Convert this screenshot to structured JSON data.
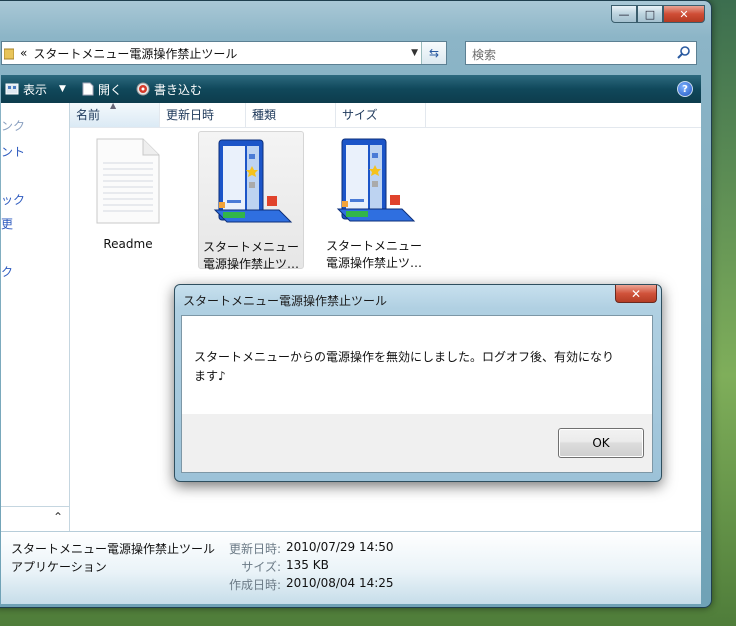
{
  "window": {
    "caption_buttons": {
      "minimize": "—",
      "maximize": "□",
      "close": "✕"
    }
  },
  "address": {
    "chevron": "«",
    "path": "スタートメニュー電源操作禁止ツール",
    "search_placeholder": "検索"
  },
  "toolbar": {
    "view_label": "表示",
    "open_label": "開く",
    "burn_label": "書き込む",
    "help": "?"
  },
  "nav": {
    "items": [
      "ンク",
      "ント",
      "ック",
      "更",
      "ク"
    ]
  },
  "columns": [
    "名前",
    "更新日時",
    "種類",
    "サイズ"
  ],
  "files": [
    {
      "name": "Readme",
      "icon": "text-document-icon"
    },
    {
      "name": "スタートメニュー電源操作禁止ツ…",
      "name_line1": "スタートメニュー",
      "name_line2": "電源操作禁止ツ…",
      "icon": "app-icon"
    },
    {
      "name": "スタートメニュー電源操作禁止ツ…",
      "name_line1": "スタートメニュー",
      "name_line2": "電源操作禁止ツ…",
      "icon": "app-icon"
    }
  ],
  "details": {
    "name": "スタートメニュー電源操作禁止ツール",
    "type": "アプリケーション",
    "modified_label": "更新日時:",
    "modified": "2010/07/29 14:50",
    "size_label": "サイズ:",
    "size": "135 KB",
    "created_label": "作成日時:",
    "created": "2010/08/04 14:25"
  },
  "dialog": {
    "title": "スタートメニュー電源操作禁止ツール",
    "close": "✕",
    "message_line1": "スタートメニューからの電源操作を無効にしました。ログオフ後、有効になり",
    "message_line2": "ます♪",
    "ok_label": "OK"
  }
}
